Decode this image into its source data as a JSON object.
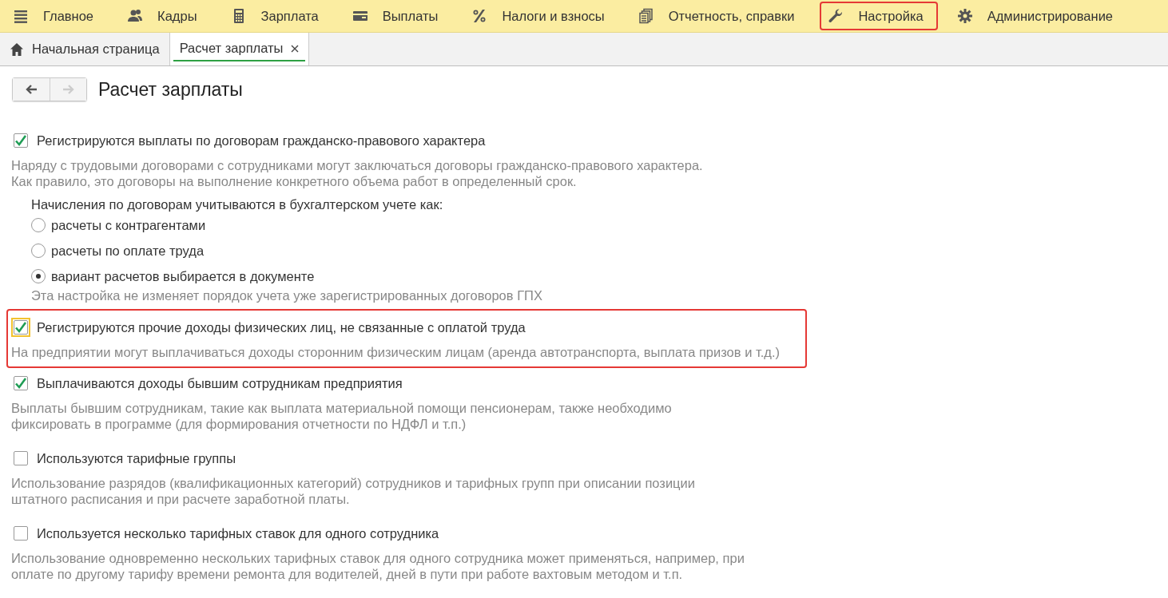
{
  "menu": [
    {
      "label": "Главное",
      "highlighted": false
    },
    {
      "label": "Кадры",
      "highlighted": false
    },
    {
      "label": "Зарплата",
      "highlighted": false
    },
    {
      "label": "Выплаты",
      "highlighted": false
    },
    {
      "label": "Налоги и взносы",
      "highlighted": false
    },
    {
      "label": "Отчетность, справки",
      "highlighted": false
    },
    {
      "label": "Настройка",
      "highlighted": true
    },
    {
      "label": "Администрирование",
      "highlighted": false
    }
  ],
  "tabs": [
    {
      "kind": "home",
      "label": "Начальная страница",
      "selected": false
    },
    {
      "kind": "page",
      "label": "Расчет зарплаты",
      "selected": true
    }
  ],
  "nav": {
    "back_disabled": false,
    "forward_disabled": true
  },
  "title": "Расчет зарплаты",
  "sections": [
    {
      "label": "Регистрируются выплаты по договорам гражданско-правового характера",
      "checked": true,
      "focused": false,
      "highlighted": false,
      "description": [
        "Наряду с трудовыми договорами с сотрудниками могут заключаться договоры гражданско-правового характера.",
        "Как правило, это договоры на выполнение конкретного объема работ в определенный срок."
      ],
      "options_label": "Начисления по договорам учитываются в бухгалтерском учете как:",
      "options": [
        {
          "label": "расчеты с контрагентами",
          "selected": false
        },
        {
          "label": "расчеты по оплате труда",
          "selected": false
        },
        {
          "label": "вариант расчетов выбирается в документе",
          "selected": true
        }
      ],
      "note": "Эта настройка не изменяет порядок учета уже зарегистрированных договоров ГПХ"
    },
    {
      "label": "Регистрируются прочие доходы физических лиц, не связанные с оплатой труда",
      "checked": true,
      "focused": true,
      "highlighted": true,
      "description": [
        "На предприятии могут выплачиваться доходы сторонним физическим лицам (аренда автотранспорта, выплата призов и т.д.)"
      ]
    },
    {
      "label": "Выплачиваются доходы бывшим сотрудникам предприятия",
      "checked": true,
      "focused": false,
      "highlighted": false,
      "description": [
        "Выплаты бывшим сотрудникам, такие как выплата материальной помощи пенсионерам, также необходимо",
        "фиксировать в программе (для формирования отчетности по НДФЛ и т.п.)"
      ]
    },
    {
      "label": "Используются тарифные группы",
      "checked": false,
      "focused": false,
      "highlighted": false,
      "description": [
        "Использование разрядов (квалификационных категорий) сотрудников и тарифных групп при описании позиции",
        "штатного расписания и при расчете заработной платы."
      ]
    },
    {
      "label": "Используется несколько тарифных ставок для одного сотрудника",
      "checked": false,
      "focused": false,
      "highlighted": false,
      "description": [
        "Использование одновременно нескольких тарифных ставок для одного сотрудника может применяться, например, при",
        "оплате по другому тарифу времени ремонта для водителей, дней в пути при работе вахтовым методом и т.п."
      ]
    }
  ]
}
